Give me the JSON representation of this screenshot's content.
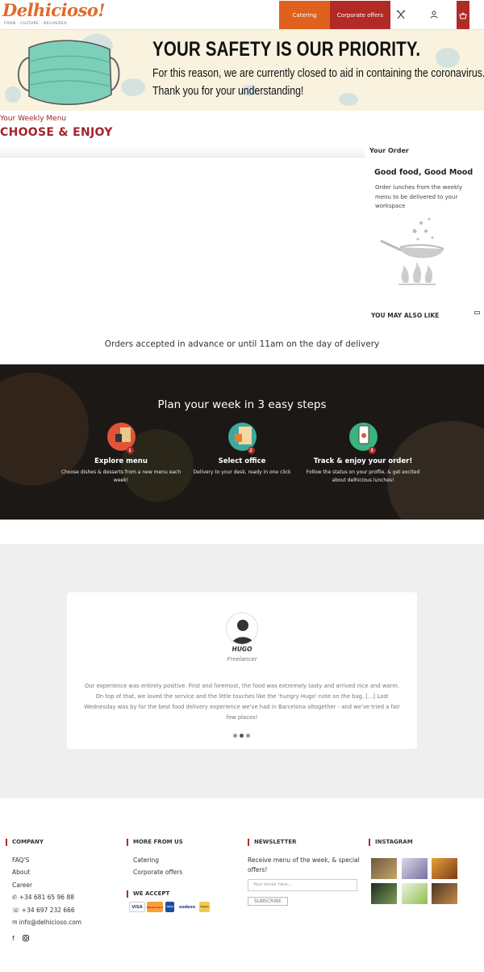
{
  "header": {
    "logo_text": "Delhicioso!",
    "logo_tagline": "FOOD · CULTURE · DELIVERED",
    "nav_catering": "Catering",
    "nav_corporate": "Corporate offers"
  },
  "banner": {
    "title": "YOUR SAFETY IS OUR PRIORITY.",
    "line1": "For this reason, we are currently closed to aid in containing the coronavirus.",
    "line2": "Thank you for your understanding!"
  },
  "menu": {
    "subtitle": "Your Weekly Menu",
    "title": "CHOOSE & ENJOY"
  },
  "order": {
    "heading": "Your Order",
    "title": "Good food, Good Mood",
    "description": "Order lunches from the weekly menu to be delivered to your workspace",
    "also_like": "YOU MAY ALSO LIKE"
  },
  "advance_note": "Orders accepted in advance or until 11am on the day of delivery",
  "steps": {
    "title": "Plan your week in 3 easy steps",
    "items": [
      {
        "badge": "1",
        "title": "Explore menu",
        "desc": "Choose dishes & desserts from a new menu each week!"
      },
      {
        "badge": "2",
        "title": "Select office",
        "desc": "Delivery to your desk, ready in one click"
      },
      {
        "badge": "3",
        "title": "Track & enjoy your order!",
        "desc": "Follow the status on your profile, & get excited about delhicious lunches!"
      }
    ]
  },
  "testimonial": {
    "name": "HUGO",
    "role": "Freelancer",
    "text": "Our experience was entirely positive. First and foremost, the food was extremely tasty and arrived nice and warm. On top of that, we loved the service and the little touches like the 'hungry Hugo' note on the bag. [...] Last Wednesday was by far the best food delivery experience we've had in Barcelona altogether - and we've tried a fair few places!",
    "slides": 3,
    "active_slide": 2
  },
  "footer": {
    "company": {
      "heading": "COMPANY",
      "links": [
        "FAQ'S",
        "About",
        "Career"
      ],
      "phone1": "+34 681 65 96 88",
      "phone2": "+34 697 232 666",
      "email": "info@delhicioso.com"
    },
    "more": {
      "heading": "MORE FROM US",
      "links": [
        "Catering",
        "Corporate offers"
      ]
    },
    "we_accept": {
      "heading": "WE ACCEPT",
      "logos": [
        "VISA",
        "MasterCard",
        "Ticket",
        "sodexo",
        "Cheque"
      ]
    },
    "newsletter": {
      "heading": "NEWSLETTER",
      "text": "Receive menu of the week, & special offers!",
      "placeholder": "Your email here...",
      "button": "SUBSCRIBE"
    },
    "instagram": {
      "heading": "INSTAGRAM"
    }
  },
  "colors": {
    "orange": "#e0601e",
    "red": "#b22a25",
    "banner_bg": "#f8f2df",
    "steps_bg": "#1c1815",
    "testimonial_bg": "#efefef"
  }
}
